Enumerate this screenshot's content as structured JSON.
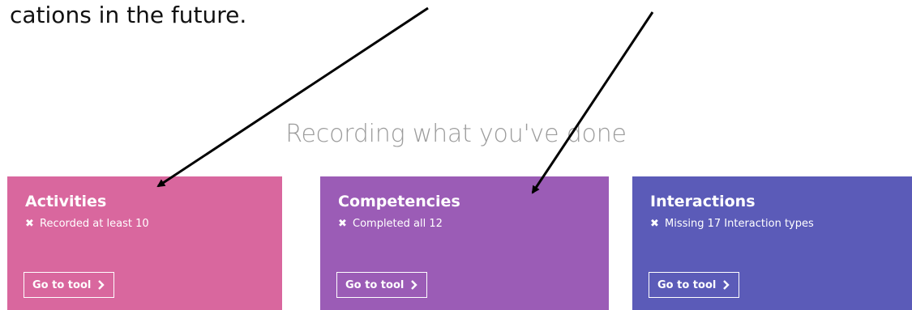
{
  "document": {
    "text_fragment": "cations in the future."
  },
  "section": {
    "title": "Recording what you've done"
  },
  "cards": [
    {
      "title": "Activities",
      "status_icon": "x-icon",
      "status": "Recorded at least 10",
      "button_label": "Go to tool",
      "color": "#d9679e"
    },
    {
      "title": "Competencies",
      "status_icon": "x-icon",
      "status": "Completed all 12",
      "button_label": "Go to tool",
      "color": "#9b5cb6"
    },
    {
      "title": "Interactions",
      "status_icon": "x-icon",
      "status": "Missing 17 Interaction types",
      "button_label": "Go to tool",
      "color": "#5b5bb8"
    }
  ],
  "annotation": {
    "arrow_color": "#000000",
    "arrow_count": 2
  }
}
